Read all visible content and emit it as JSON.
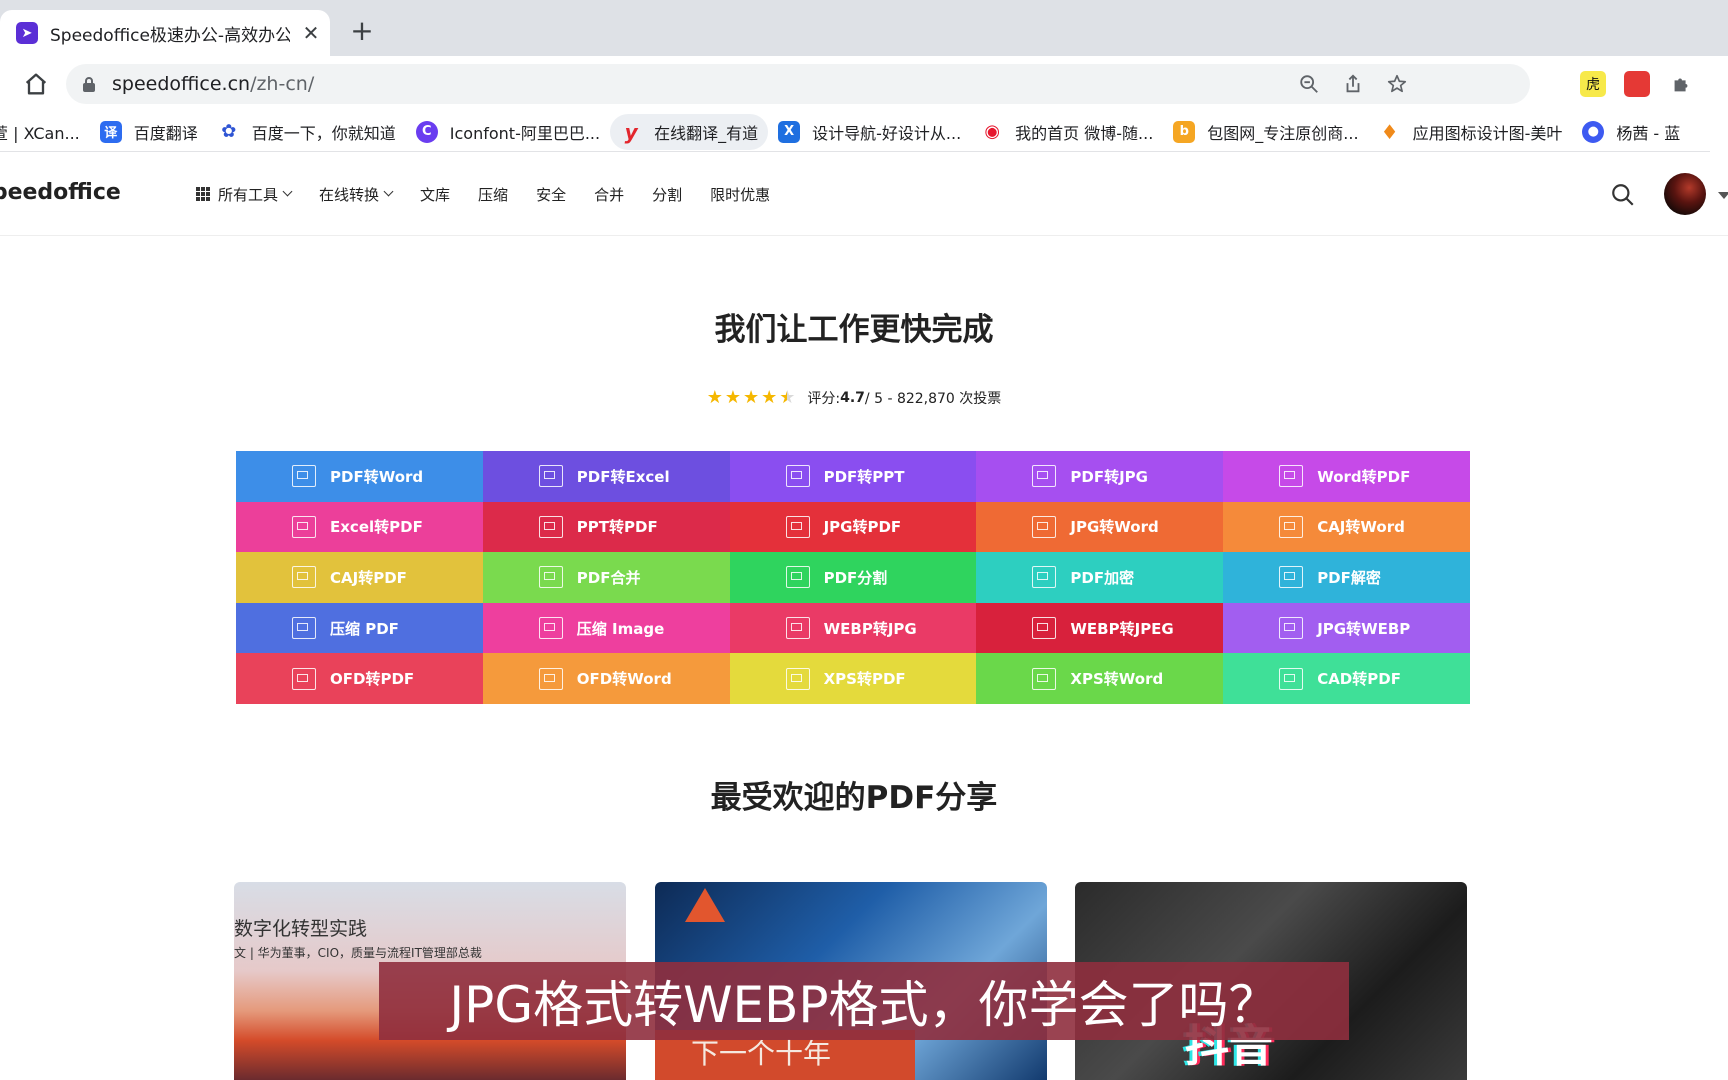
{
  "browser": {
    "tab": {
      "title": "Speedoffice极速办公-高效办公",
      "favicon": "rocket-icon"
    },
    "url": {
      "host": "speedoffice.cn",
      "path": "/zh-cn/"
    },
    "bookmarks": [
      {
        "label": "萱 | XCan...",
        "icon": "xcan-icon",
        "color": "#ffffff"
      },
      {
        "label": "百度翻译",
        "icon": "baidu-translate-icon",
        "color": "#2d6cf0"
      },
      {
        "label": "百度一下，你就知道",
        "icon": "baidu-paw-icon",
        "color": "#2f55d4"
      },
      {
        "label": "Iconfont-阿里巴巴...",
        "icon": "iconfont-icon",
        "color": "#6a3df0"
      },
      {
        "label": "在线翻译_有道",
        "icon": "youdao-icon",
        "color": "#e3262d"
      },
      {
        "label": "设计导航-好设计从...",
        "icon": "design-nav-icon",
        "color": "#1f6fe0"
      },
      {
        "label": "我的首页 微博-随...",
        "icon": "weibo-icon",
        "color": "#e6162d"
      },
      {
        "label": "包图网_专注原创商...",
        "icon": "baotu-icon",
        "color": "#f5a623"
      },
      {
        "label": "应用图标设计图-美叶",
        "icon": "meiye-icon",
        "color": "#f08a1a"
      },
      {
        "label": "杨茜 - 蓝",
        "icon": "lanhu-icon",
        "color": "#3d5af1"
      }
    ],
    "extensions": [
      {
        "name": "tiger-extension-icon",
        "glyph": "虎",
        "color": "#f7e94a"
      },
      {
        "name": "red-extension-icon",
        "glyph": "",
        "color": "#e53935"
      }
    ]
  },
  "site": {
    "logo": "Speedoffice",
    "nav": [
      {
        "label": "所有工具",
        "has_grid": true,
        "dropdown": true
      },
      {
        "label": "在线转换",
        "dropdown": true
      },
      {
        "label": "文库"
      },
      {
        "label": "压缩"
      },
      {
        "label": "安全"
      },
      {
        "label": "合并"
      },
      {
        "label": "分割"
      },
      {
        "label": "限时优惠"
      }
    ],
    "hero_title": "我们让工作更快完成",
    "rating": {
      "stars": 4.5,
      "prefix": "评分: ",
      "score": "4.7",
      "suffix": " / 5 - 822,870 次投票"
    },
    "tools": [
      {
        "label": "PDF转Word",
        "color": "#3d8ee8"
      },
      {
        "label": "PDF转Excel",
        "color": "#6d4fe0"
      },
      {
        "label": "PDF转PPT",
        "color": "#8a4ef0"
      },
      {
        "label": "PDF转JPG",
        "color": "#a64ff0"
      },
      {
        "label": "Word转PDF",
        "color": "#c64ae8"
      },
      {
        "label": "Excel转PDF",
        "color": "#ec3f9a"
      },
      {
        "label": "PPT转PDF",
        "color": "#dc2a4a"
      },
      {
        "label": "JPG转PDF",
        "color": "#e4303a"
      },
      {
        "label": "JPG转Word",
        "color": "#ef6a34"
      },
      {
        "label": "CAJ转Word",
        "color": "#f58a3a"
      },
      {
        "label": "CAJ转PDF",
        "color": "#e2c23c"
      },
      {
        "label": "PDF合并",
        "color": "#7ada4e"
      },
      {
        "label": "PDF分割",
        "color": "#2fd45e"
      },
      {
        "label": "PDF加密",
        "color": "#2dcfc0"
      },
      {
        "label": "PDF解密",
        "color": "#2fb3da"
      },
      {
        "label": "压缩 PDF",
        "color": "#4f6fe0"
      },
      {
        "label": "压缩 Image",
        "color": "#ee3f9e"
      },
      {
        "label": "WEBP转JPG",
        "color": "#ea3a66"
      },
      {
        "label": "WEBP转JPEG",
        "color": "#d8213c"
      },
      {
        "label": "JPG转WEBP",
        "color": "#a25ef0"
      },
      {
        "label": "OFD转PDF",
        "color": "#e9425a"
      },
      {
        "label": "OFD转Word",
        "color": "#f59a3c"
      },
      {
        "label": "XPS转PDF",
        "color": "#e4da3c"
      },
      {
        "label": "XPS转Word",
        "color": "#6ad84a"
      },
      {
        "label": "CAD转PDF",
        "color": "#3fe098"
      }
    ],
    "section_title": "最受欢迎的PDF分享",
    "cards": [
      {
        "title": "数字化转型实践",
        "subtitle": "文 | 华为董事，CIO，质量与流程IT管理部总裁"
      },
      {
        "title": "下一个十年"
      },
      {
        "title": "抖音"
      }
    ]
  },
  "overlay": {
    "subtitle": "JPG格式转WEBP格式，你学会了吗？"
  }
}
